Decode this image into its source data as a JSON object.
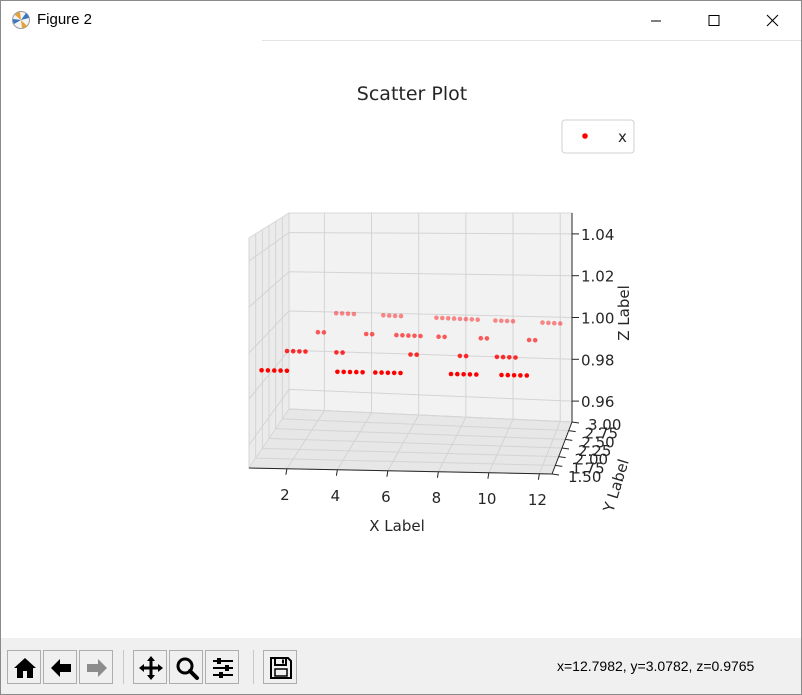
{
  "window": {
    "title": "Figure 2",
    "controls": [
      "minimize",
      "maximize",
      "close"
    ]
  },
  "toolbar": {
    "buttons": [
      {
        "name": "home",
        "icon": "home-icon"
      },
      {
        "name": "back",
        "icon": "arrow-left-icon"
      },
      {
        "name": "forward",
        "icon": "arrow-right-icon"
      },
      {
        "name": "pan",
        "icon": "move-icon"
      },
      {
        "name": "zoom",
        "icon": "magnifier-icon"
      },
      {
        "name": "configure-subplots",
        "icon": "sliders-icon"
      },
      {
        "name": "save",
        "icon": "floppy-disk-icon"
      }
    ],
    "status": "x=12.7982, y=3.0782, z=0.9765"
  },
  "chart_data": {
    "type": "scatter",
    "projection": "3d",
    "title": "Scatter Plot",
    "xlabel": "X Label",
    "ylabel": "Y Label",
    "zlabel": "Z Label",
    "xticks": [
      "2",
      "4",
      "6",
      "8",
      "10",
      "12"
    ],
    "yticks": [
      "1.50",
      "1.75",
      "2.00",
      "2.25",
      "2.50",
      "2.75",
      "3.00"
    ],
    "zticks": [
      "0.96",
      "0.98",
      "1.00",
      "1.02",
      "1.04"
    ],
    "xlim": [
      0.5,
      12.5
    ],
    "ylim": [
      1.5,
      3.0
    ],
    "zlim": [
      0.95,
      1.05
    ],
    "legend": {
      "placement": "upper right",
      "entries": [
        "x"
      ]
    },
    "marker_color": "#ff0000",
    "z_value": 1.0,
    "series": [
      {
        "name": "x",
        "note": "dot-matrix glyphs '2023 7/28' drawn as points in the x-y plane at z=1",
        "x": [
          1.0,
          1.25,
          1.5,
          1.75,
          2.0,
          4.0,
          4.25,
          4.5,
          4.75,
          5.0,
          5.5,
          5.75,
          6.0,
          6.25,
          6.5,
          8.5,
          8.75,
          9.0,
          9.25,
          9.5,
          10.5,
          10.75,
          11.0,
          11.25,
          11.5,
          1.5,
          1.75,
          2.0,
          2.25,
          3.5,
          3.75,
          6.5,
          6.75,
          8.5,
          8.75,
          10.0,
          10.25,
          10.5,
          10.75,
          2.25,
          2.5,
          4.25,
          4.5,
          5.5,
          5.75,
          6.0,
          6.25,
          6.5,
          7.25,
          7.5,
          9.0,
          9.25,
          11.0,
          11.25,
          2.5,
          2.75,
          3.0,
          3.25,
          4.5,
          4.75,
          5.0,
          5.25,
          6.75,
          7.0,
          7.25,
          7.5,
          7.75,
          8.0,
          8.25,
          8.5,
          9.25,
          9.5,
          9.75,
          10.0,
          11.25,
          11.5,
          11.75,
          12.0
        ],
        "y": [
          1.5,
          1.5,
          1.5,
          1.5,
          1.5,
          1.5,
          1.5,
          1.5,
          1.5,
          1.5,
          1.5,
          1.5,
          1.5,
          1.5,
          1.5,
          1.5,
          1.5,
          1.5,
          1.5,
          1.5,
          1.5,
          1.5,
          1.5,
          1.5,
          1.5,
          2.0,
          2.0,
          2.0,
          2.0,
          2.0,
          2.0,
          2.0,
          2.0,
          2.0,
          2.0,
          2.0,
          2.0,
          2.0,
          2.0,
          2.5,
          2.5,
          2.5,
          2.5,
          2.5,
          2.5,
          2.5,
          2.5,
          2.5,
          2.5,
          2.5,
          2.5,
          2.5,
          2.5,
          2.5,
          3.0,
          3.0,
          3.0,
          3.0,
          3.0,
          3.0,
          3.0,
          3.0,
          3.0,
          3.0,
          3.0,
          3.0,
          3.0,
          3.0,
          3.0,
          3.0,
          3.0,
          3.0,
          3.0,
          3.0,
          3.0,
          3.0,
          3.0,
          3.0
        ]
      }
    ]
  }
}
